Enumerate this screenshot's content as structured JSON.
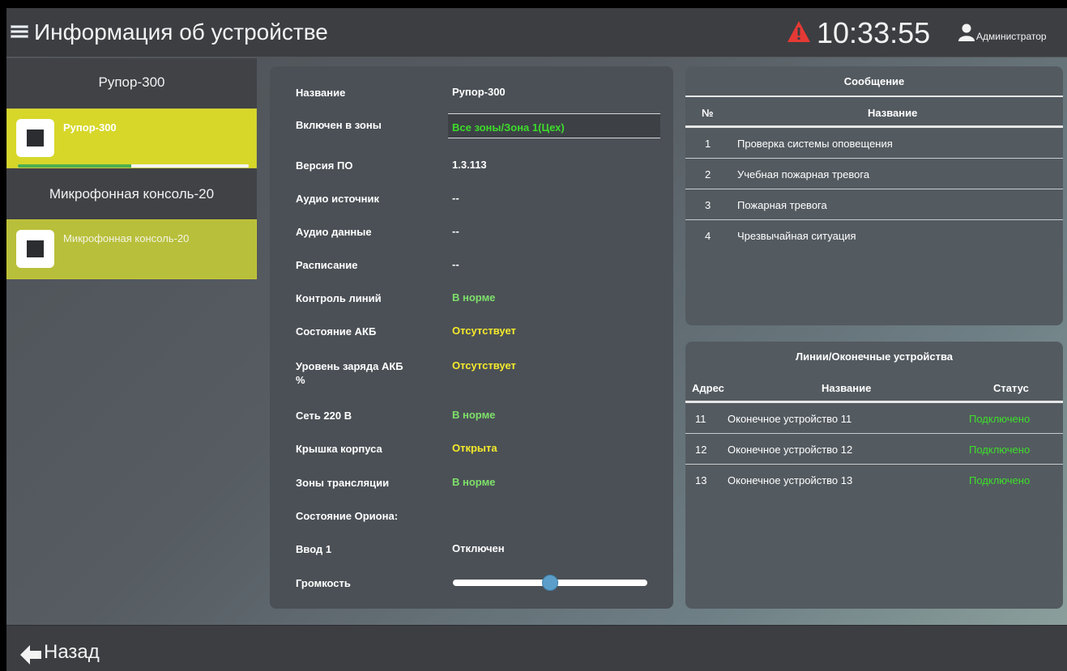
{
  "header": {
    "title": "Информация об устройстве",
    "time": "10:33:55",
    "user": "Администратор"
  },
  "sidebar": {
    "groups": [
      {
        "header": "Рупор-300",
        "device": "Рупор-300",
        "selected": true,
        "progress": 0.49
      },
      {
        "header": "Микрофонная консоль-20",
        "device": "Микрофонная консоль-20",
        "selected": false
      }
    ]
  },
  "info": {
    "name_label": "Название",
    "name_value": "Рупор-300",
    "zones_label": "Включен в зоны",
    "zones_value": "Все зоны/Зона 1(Цех)",
    "firmware_label": "Версия ПО",
    "firmware_value": "1.3.113",
    "audio_source_label": "Аудио источник",
    "audio_source_value": "--",
    "audio_data_label": "Аудио данные",
    "audio_data_value": "--",
    "schedule_label": "Расписание",
    "schedule_value": "--",
    "line_control_label": "Контроль линий",
    "line_control_value": "В норме",
    "battery_state_label": "Состояние АКБ",
    "battery_state_value": "Отсутствует",
    "battery_level_label": "Уровень заряда АКБ %",
    "battery_level_value": "Отсутствует",
    "mains_label": "Сеть 220 В",
    "mains_value": "В норме",
    "cover_label": "Крышка корпуса",
    "cover_value": "Открыта",
    "broadcast_zones_label": "Зоны трансляции",
    "broadcast_zones_value": "В норме",
    "orion_label": "Состояние Ориона:",
    "input1_label": "Ввод 1",
    "input1_value": "Отключен",
    "volume_label": "Громкость",
    "volume_level": 0.5
  },
  "messages": {
    "title": "Сообщение",
    "col_num": "№",
    "col_name": "Название",
    "rows": [
      {
        "num": "1",
        "name": "Проверка системы оповещения"
      },
      {
        "num": "2",
        "name": "Учебная пожарная тревога"
      },
      {
        "num": "3",
        "name": "Пожарная тревога"
      },
      {
        "num": "4",
        "name": "Чрезвычайная ситуация"
      }
    ]
  },
  "lines": {
    "title": "Линии/Оконечные устройства",
    "col_address": "Адрес",
    "col_name": "Название",
    "col_status": "Статус",
    "rows": [
      {
        "address": "11",
        "name": "Оконечное устройство 11",
        "status": "Подключено"
      },
      {
        "address": "12",
        "name": "Оконечное устройство 12",
        "status": "Подключено"
      },
      {
        "address": "13",
        "name": "Оконечное устройство 13",
        "status": "Подключено"
      }
    ]
  },
  "footer": {
    "back_label": "Назад"
  },
  "colors": {
    "header_bg": "#3c3e42",
    "selected_device": "#d7d72a",
    "ok_green": "#7ee06a",
    "warn_yellow": "#f5ea2b",
    "alert_red": "#e53935"
  },
  "icons": {
    "menu": "menu-icon",
    "alert": "alert-triangle-icon",
    "user": "user-icon",
    "device": "device-square-icon",
    "back": "arrow-left-icon"
  }
}
